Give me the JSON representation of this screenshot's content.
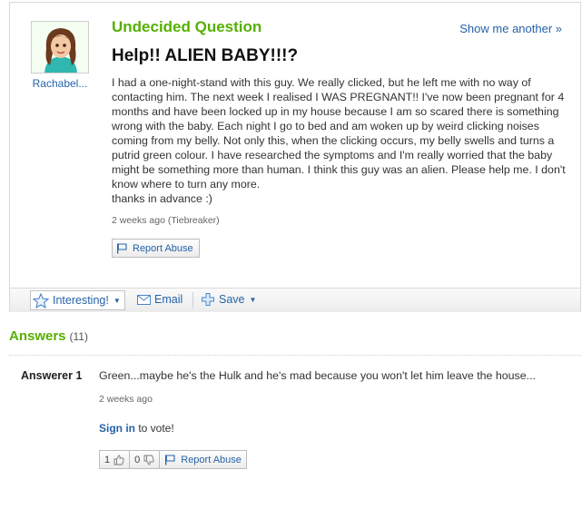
{
  "question": {
    "type_label": "Undecided Question",
    "show_another_label": "Show me another »",
    "asker_name": "Rachabel...",
    "title": "Help!! ALIEN BABY!!!?",
    "body": "I had a one-night-stand with this guy. We really clicked, but he left me with no way of contacting him. The next week I realised I WAS PREGNANT!! I've now been pregnant for 4 months and have been locked up in my house because I am so scared there is something wrong with the baby. Each night I go to bed and am woken up by weird clicking noises coming from my belly. Not only this, when the clicking occurs, my belly swells and turns a putrid green colour. I have researched the symptoms and I'm really worried that the baby might be something more than human. I think this guy was an alien. Please help me. I don't know where to turn any more.\nthanks in advance :)",
    "meta": "2 weeks ago (Tiebreaker)",
    "report_label": "Report Abuse"
  },
  "actions": {
    "interesting_label": "Interesting!",
    "email_label": "Email",
    "save_label": "Save"
  },
  "answers": {
    "heading": "Answers",
    "count": "(11)",
    "items": [
      {
        "author": "Answerer 1",
        "text": "Green...maybe he's the Hulk and he's mad because you won't let him leave the house...",
        "meta": "2 weeks ago",
        "signin_link": "Sign in",
        "signin_suffix": " to vote!",
        "thumbs_up": "1",
        "thumbs_down": "0",
        "report_label": "Report Abuse"
      }
    ]
  },
  "colors": {
    "brand_green": "#55b000",
    "link_blue": "#2563a8"
  },
  "icons": [
    "avatar",
    "flag-icon",
    "star-icon",
    "caret-down-icon",
    "envelope-icon",
    "plus-icon",
    "thumbs-up-icon",
    "thumbs-down-icon"
  ]
}
